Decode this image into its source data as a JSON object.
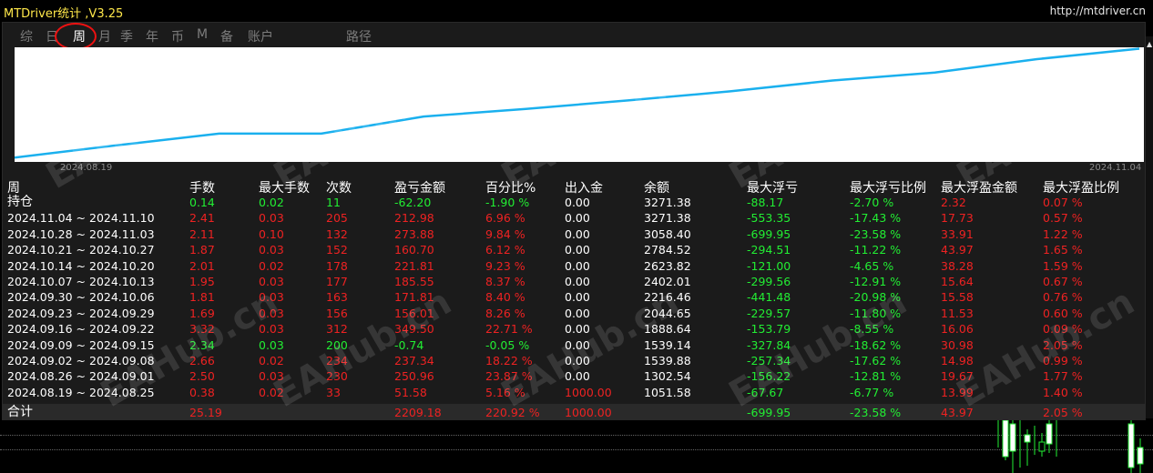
{
  "window": {
    "title": "MTDriver统计 ,V3.25",
    "url": "http://mtdriver.cn"
  },
  "tabs": [
    {
      "label": "综",
      "active": false
    },
    {
      "label": "日",
      "active": false
    },
    {
      "label": "周",
      "active": true
    },
    {
      "label": "月",
      "active": false
    },
    {
      "label": "季",
      "active": false
    },
    {
      "label": "年",
      "active": false
    },
    {
      "label": "币",
      "active": false
    },
    {
      "label": "M",
      "active": false
    },
    {
      "label": "备",
      "active": false
    },
    {
      "label": "账户",
      "active": false
    },
    {
      "label": "路径",
      "active": false
    }
  ],
  "chart_data": {
    "type": "line",
    "start_label": "2024.08.19",
    "end_label": "2024.11.04",
    "x": [
      "2024.08.19",
      "2024.08.26",
      "2024.09.02",
      "2024.09.09",
      "2024.09.16",
      "2024.09.23",
      "2024.09.30",
      "2024.10.07",
      "2024.10.14",
      "2024.10.21",
      "2024.10.28",
      "2024.11.04"
    ],
    "values": [
      1051.58,
      1302.54,
      1539.88,
      1539.14,
      1888.64,
      2044.65,
      2216.46,
      2402.01,
      2623.82,
      2784.52,
      3058.4,
      3271.38
    ],
    "ylim": [
      1000,
      3300
    ],
    "line_color": "#1ab0ee"
  },
  "watermark": "EAHub.cn",
  "table": {
    "period_header": "周",
    "columns": [
      "手数",
      "最大手数",
      "次数",
      "盈亏金额",
      "百分比%",
      "出入金",
      "余额",
      "最大浮亏",
      "最大浮亏比例",
      "最大浮盈金额",
      "最大浮盈比例"
    ],
    "rows": [
      {
        "label": "持仓",
        "cells": [
          "0.14",
          "0.02",
          "11",
          "-62.20",
          "-1.90 %",
          "0.00",
          "3271.38",
          "-88.17",
          "-2.70 %",
          "2.32",
          "0.07 %"
        ],
        "colors": [
          "pos",
          "pos",
          "pos",
          "pos",
          "pos",
          "neu",
          "neu",
          "pos",
          "pos",
          "neg",
          "neg"
        ]
      },
      {
        "label": "2024.11.04 ~ 2024.11.10",
        "cells": [
          "2.41",
          "0.03",
          "205",
          "212.98",
          "6.96 %",
          "0.00",
          "3271.38",
          "-553.35",
          "-17.43 %",
          "17.73",
          "0.57 %"
        ],
        "colors": [
          "neg",
          "neg",
          "neg",
          "neg",
          "neg",
          "neu",
          "neu",
          "pos",
          "pos",
          "neg",
          "neg"
        ]
      },
      {
        "label": "2024.10.28 ~ 2024.11.03",
        "cells": [
          "2.11",
          "0.10",
          "132",
          "273.88",
          "9.84 %",
          "0.00",
          "3058.40",
          "-699.95",
          "-23.58 %",
          "33.91",
          "1.22 %"
        ],
        "colors": [
          "neg",
          "neg",
          "neg",
          "neg",
          "neg",
          "neu",
          "neu",
          "pos",
          "pos",
          "neg",
          "neg"
        ]
      },
      {
        "label": "2024.10.21 ~ 2024.10.27",
        "cells": [
          "1.87",
          "0.03",
          "152",
          "160.70",
          "6.12 %",
          "0.00",
          "2784.52",
          "-294.51",
          "-11.22 %",
          "43.97",
          "1.65 %"
        ],
        "colors": [
          "neg",
          "neg",
          "neg",
          "neg",
          "neg",
          "neu",
          "neu",
          "pos",
          "pos",
          "neg",
          "neg"
        ]
      },
      {
        "label": "2024.10.14 ~ 2024.10.20",
        "cells": [
          "2.01",
          "0.02",
          "178",
          "221.81",
          "9.23 %",
          "0.00",
          "2623.82",
          "-121.00",
          "-4.65 %",
          "38.28",
          "1.59 %"
        ],
        "colors": [
          "neg",
          "neg",
          "neg",
          "neg",
          "neg",
          "neu",
          "neu",
          "pos",
          "pos",
          "neg",
          "neg"
        ]
      },
      {
        "label": "2024.10.07 ~ 2024.10.13",
        "cells": [
          "1.95",
          "0.03",
          "177",
          "185.55",
          "8.37 %",
          "0.00",
          "2402.01",
          "-299.56",
          "-12.91 %",
          "15.64",
          "0.67 %"
        ],
        "colors": [
          "neg",
          "neg",
          "neg",
          "neg",
          "neg",
          "neu",
          "neu",
          "pos",
          "pos",
          "neg",
          "neg"
        ]
      },
      {
        "label": "2024.09.30 ~ 2024.10.06",
        "cells": [
          "1.81",
          "0.03",
          "163",
          "171.81",
          "8.40 %",
          "0.00",
          "2216.46",
          "-441.48",
          "-20.98 %",
          "15.58",
          "0.76 %"
        ],
        "colors": [
          "neg",
          "neg",
          "neg",
          "neg",
          "neg",
          "neu",
          "neu",
          "pos",
          "pos",
          "neg",
          "neg"
        ]
      },
      {
        "label": "2024.09.23 ~ 2024.09.29",
        "cells": [
          "1.69",
          "0.03",
          "156",
          "156.01",
          "8.26 %",
          "0.00",
          "2044.65",
          "-229.57",
          "-11.80 %",
          "11.53",
          "0.60 %"
        ],
        "colors": [
          "neg",
          "neg",
          "neg",
          "neg",
          "neg",
          "neu",
          "neu",
          "pos",
          "pos",
          "neg",
          "neg"
        ]
      },
      {
        "label": "2024.09.16 ~ 2024.09.22",
        "cells": [
          "3.32",
          "0.03",
          "312",
          "349.50",
          "22.71 %",
          "0.00",
          "1888.64",
          "-153.79",
          "-8.55 %",
          "16.06",
          "0.09 %"
        ],
        "colors": [
          "neg",
          "neg",
          "neg",
          "neg",
          "neg",
          "neu",
          "neu",
          "pos",
          "pos",
          "neg",
          "neg"
        ]
      },
      {
        "label": "2024.09.09 ~ 2024.09.15",
        "cells": [
          "2.34",
          "0.03",
          "200",
          "-0.74",
          "-0.05 %",
          "0.00",
          "1539.14",
          "-327.84",
          "-18.62 %",
          "30.98",
          "2.05 %"
        ],
        "colors": [
          "pos",
          "pos",
          "pos",
          "pos",
          "pos",
          "neu",
          "neu",
          "pos",
          "pos",
          "neg",
          "neg"
        ]
      },
      {
        "label": "2024.09.02 ~ 2024.09.08",
        "cells": [
          "2.66",
          "0.02",
          "234",
          "237.34",
          "18.22 %",
          "0.00",
          "1539.88",
          "-257.34",
          "-17.62 %",
          "14.98",
          "0.99 %"
        ],
        "colors": [
          "neg",
          "neg",
          "neg",
          "neg",
          "neg",
          "neu",
          "neu",
          "pos",
          "pos",
          "neg",
          "neg"
        ]
      },
      {
        "label": "2024.08.26 ~ 2024.09.01",
        "cells": [
          "2.50",
          "0.03",
          "230",
          "250.96",
          "23.87 %",
          "0.00",
          "1302.54",
          "-156.22",
          "-12.81 %",
          "19.67",
          "1.77 %"
        ],
        "colors": [
          "neg",
          "neg",
          "neg",
          "neg",
          "neg",
          "neu",
          "neu",
          "pos",
          "pos",
          "neg",
          "neg"
        ]
      },
      {
        "label": "2024.08.19 ~ 2024.08.25",
        "cells": [
          "0.38",
          "0.02",
          "33",
          "51.58",
          "5.16 %",
          "1000.00",
          "1051.58",
          "-67.67",
          "-6.77 %",
          "13.99",
          "1.40 %"
        ],
        "colors": [
          "neg",
          "neg",
          "neg",
          "neg",
          "neg",
          "neg",
          "neu",
          "pos",
          "pos",
          "neg",
          "neg"
        ]
      }
    ],
    "summary": {
      "label": "合计",
      "cells": [
        "25.19",
        "",
        "",
        "2209.18",
        "220.92 %",
        "1000.00",
        "",
        "-699.95",
        "-23.58 %",
        "43.97",
        "2.05 %"
      ],
      "colors": [
        "neg",
        "neg",
        "neg",
        "neg",
        "neg",
        "neg",
        "neu",
        "pos",
        "pos",
        "neg",
        "neg"
      ]
    }
  }
}
